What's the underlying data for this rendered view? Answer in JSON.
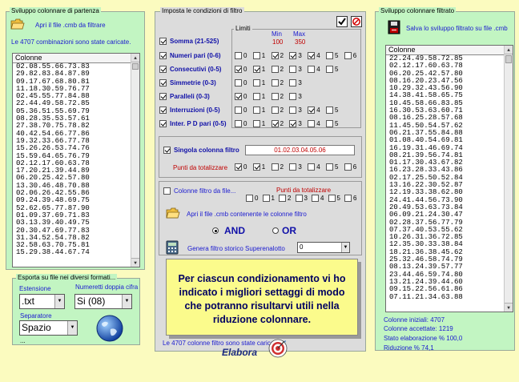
{
  "left": {
    "panel_title": "Sviluppo colonnare di partenza",
    "open_label": "Apri il  file .cmb da filtrare",
    "status": "Le 4707 combinazioni sono state caricate.",
    "list_header": "Colonne",
    "rows": [
      "02.08.55.66.73.83",
      "29.82.83.84.87.89",
      "09.17.67.68.80.81",
      "11.18.30.59.76.77",
      "02.45.55.77.84.88",
      "22.44.49.58.72.85",
      "05.36.51.55.69.79",
      "08.28.35.53.57.61",
      "27.38.70.75.78.82",
      "40.42.54.66.77.86",
      "19.32.33.66.77.78",
      "15.26.26.53.74.76",
      "15.59.64.65.76.79",
      "02.12.17.60.63.78",
      "17.20.21.39.44.89",
      "06.20.25.42.57.80",
      "13.30.46.48.70.88",
      "02.06.26.42.55.86",
      "09.24.39.48.69.75",
      "52.62.65.77.87.90",
      "01.09.37.69.71.83",
      "03.13.39.40.49.75",
      "20.30.47.69.77.83",
      "31.34.52.54.78.82",
      "32.58.63.70.75.81",
      "15.29.38.44.67.74"
    ],
    "export": {
      "title": "Esporta su file nei diversi formati...",
      "ext_label": "Estensione",
      "ext_value": ".txt",
      "doublenum_label": "Numeretti doppia cifra",
      "doublenum_value": "Si (08)",
      "sep_label": "Separatore",
      "sep_value": "Spazio",
      "ellipsis": "..."
    }
  },
  "middle": {
    "panel_title": "Imposta le condizioni di filtro",
    "limits_title": "Limiti",
    "min_label": "Min",
    "max_label": "Max",
    "min_value": "100",
    "max_value": "350",
    "filters": [
      {
        "label": "Somma (21-525)",
        "checked": true,
        "options": []
      },
      {
        "label": "Numeri pari (0-6)",
        "checked": true,
        "options": [
          {
            "n": "0",
            "c": false
          },
          {
            "n": "1",
            "c": false
          },
          {
            "n": "2",
            "c": true
          },
          {
            "n": "3",
            "c": true
          },
          {
            "n": "4",
            "c": true
          },
          {
            "n": "5",
            "c": false
          },
          {
            "n": "6",
            "c": false
          }
        ]
      },
      {
        "label": "Consecutivi (0-5)",
        "checked": true,
        "options": [
          {
            "n": "0",
            "c": true
          },
          {
            "n": "1",
            "c": true
          },
          {
            "n": "2",
            "c": false
          },
          {
            "n": "3",
            "c": false
          },
          {
            "n": "4",
            "c": false
          },
          {
            "n": "5",
            "c": false
          }
        ]
      },
      {
        "label": "Simmetrie (0-3)",
        "checked": true,
        "options": [
          {
            "n": "0",
            "c": false
          },
          {
            "n": "1",
            "c": false
          },
          {
            "n": "2",
            "c": false
          },
          {
            "n": "3",
            "c": false
          }
        ]
      },
      {
        "label": "Paralleli (0-3)",
        "checked": true,
        "options": [
          {
            "n": "0",
            "c": true
          },
          {
            "n": "1",
            "c": false
          },
          {
            "n": "2",
            "c": false
          },
          {
            "n": "3",
            "c": false
          }
        ]
      },
      {
        "label": "Interruzioni (0-5)",
        "checked": true,
        "options": [
          {
            "n": "0",
            "c": false
          },
          {
            "n": "1",
            "c": false
          },
          {
            "n": "2",
            "c": false
          },
          {
            "n": "3",
            "c": false
          },
          {
            "n": "4",
            "c": true
          },
          {
            "n": "5",
            "c": false
          }
        ]
      },
      {
        "label": "Inter. P D pari (0-5)",
        "checked": true,
        "options": [
          {
            "n": "0",
            "c": false
          },
          {
            "n": "1",
            "c": false
          },
          {
            "n": "2",
            "c": true
          },
          {
            "n": "3",
            "c": true
          },
          {
            "n": "4",
            "c": false
          },
          {
            "n": "5",
            "c": false
          }
        ]
      }
    ],
    "single": {
      "label": "Singola colonna filtro",
      "value": "01.02.03.04.05.06",
      "points_label": "Punti da totalizzare",
      "options": [
        {
          "n": "0",
          "c": true
        },
        {
          "n": "1",
          "c": true
        },
        {
          "n": "2",
          "c": false
        },
        {
          "n": "3",
          "c": false
        },
        {
          "n": "4",
          "c": false
        },
        {
          "n": "5",
          "c": false
        },
        {
          "n": "6",
          "c": false
        }
      ]
    },
    "file_filter": {
      "label": "Colonne filtro da file...",
      "points_label": "Punti da totalizzare",
      "options": [
        {
          "n": "0",
          "c": false
        },
        {
          "n": "1",
          "c": false
        },
        {
          "n": "2",
          "c": false
        },
        {
          "n": "3",
          "c": false
        },
        {
          "n": "4",
          "c": false
        },
        {
          "n": "5",
          "c": false
        },
        {
          "n": "6",
          "c": false
        }
      ],
      "open_label": "Apri il  file .cmb contenente le colonne filtro",
      "and_label": "AND",
      "or_label": "OR"
    },
    "historic": {
      "label": "Genera filtro storico Superenalotto",
      "value": "0"
    },
    "status": "Le 4707 colonne filtro sono state caricate."
  },
  "right": {
    "panel_title": "Sviluppo colonnare filtrato",
    "save_label": "Salva lo sviluppo filtrato su file .cmb",
    "list_header": "Colonne",
    "rows": [
      "22.24.49.58.72.85",
      "02.12.17.60.63.78",
      "06.20.25.42.57.80",
      "08.16.20.23.47.56",
      "10.29.32.43.56.90",
      "14.38.41.58.65.75",
      "10.45.58.66.83.85",
      "16.30.53.63.60.71",
      "08.16.25.28.57.68",
      "11.45.50.54.57.62",
      "06.21.37.55.84.88",
      "01.08.40.54.69.81",
      "16.19.31.46.69.74",
      "08.21.39.56.74.81",
      "01.17.30.43.67.82",
      "16.23.28.33.43.86",
      "02.17.25.50.52.84",
      "13.16.22.30.52.87",
      "12.19.33.38.62.80",
      "24.41.44.56.73.90",
      "20.49.53.63.73.84",
      "06.09.21.24.30.47",
      "02.28.37.56.77.79",
      "07.37.40.53.55.62",
      "10.26.31.36.72.85",
      "12.35.30.33.38.84",
      "18.21.36.38.45.62",
      "25.32.46.58.74.79",
      "08.13.24.39.57.77",
      "23.44.46.59.74.80",
      "13.21.24.39.44.60",
      "09.15.22.56.61.86",
      "07.11.21.34.63.88"
    ],
    "stats": {
      "initial": "Colonne iniziali: 4707",
      "accepted": "Colonne accettate:  1219",
      "state": "Stato elaborazione %   100,0",
      "reduction": "Riduzione %   74,1"
    }
  },
  "tooltip": "Per ciascun condizionamento vi ho indicato i migliori settaggi di modo che potranno risultarvi utili nella riduzione colonnare.",
  "footer": {
    "process_label": "Elabora"
  },
  "colors": {
    "background": "#fbfbbf",
    "panel_green": "#c2f5c2",
    "panel_grey": "#dcdcdc",
    "label_blue": "#1010a8",
    "accent_red": "#c00000",
    "tooltip": "#fbfb8c"
  },
  "icons": [
    "folder-open-icon",
    "save-disk-icon",
    "globe-icon",
    "calculator-icon",
    "target-icon",
    "check-icon",
    "cancel-icon"
  ]
}
